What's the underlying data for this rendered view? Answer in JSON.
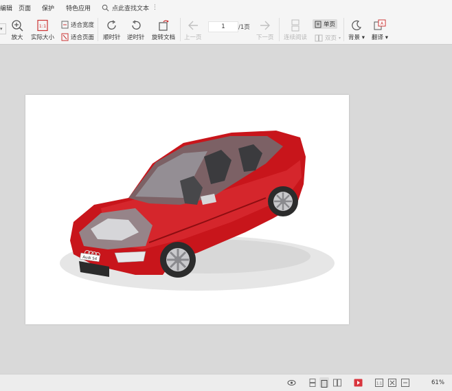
{
  "menu": {
    "items": [
      "编辑",
      "页面",
      "保护",
      "特色应用"
    ],
    "search_placeholder": "点此查找文本"
  },
  "toolbar": {
    "zoom_in": "放大",
    "actual_size": "实际大小",
    "fit_width": "适合宽度",
    "fit_page": "适合页面",
    "rotate_cw": "顺时针",
    "rotate_ccw": "逆时针",
    "rotate_doc": "旋转文档",
    "prev_page": "上一页",
    "page_current": "1",
    "page_total": "/1页",
    "next_page": "下一页",
    "continuous": "连续阅读",
    "single_page": "单页",
    "double_page": "双页",
    "background": "背景",
    "translate": "翻译"
  },
  "document": {
    "content": "Audi A4 sedan cutaway illustration",
    "plate_text": "Audi S4",
    "car_color": "#c8151b"
  },
  "status": {
    "zoom": "61%"
  }
}
